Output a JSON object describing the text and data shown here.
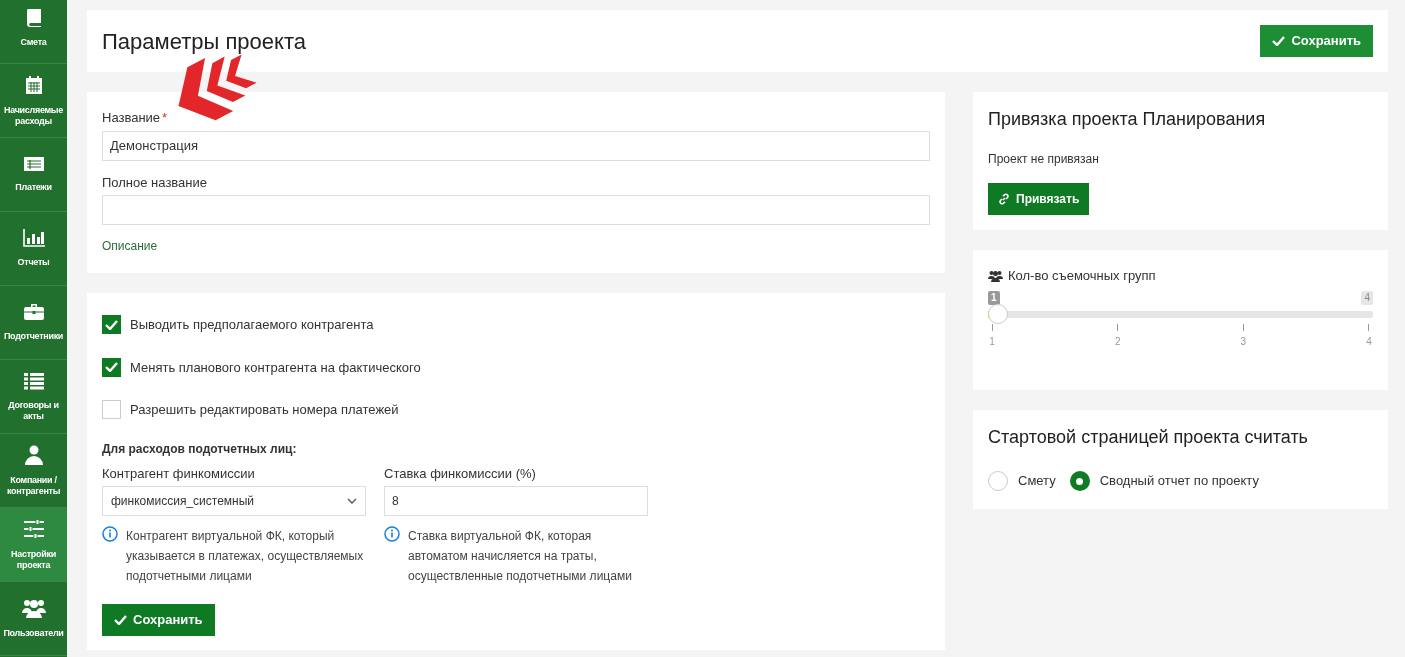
{
  "sidebar": {
    "items": [
      {
        "label": "Смета",
        "selected": false
      },
      {
        "label": "Начисляемые расходы",
        "selected": false
      },
      {
        "label": "Платежи",
        "selected": false
      },
      {
        "label": "Отчеты",
        "selected": false
      },
      {
        "label": "Подотчетники",
        "selected": false
      },
      {
        "label": "Договоры и акты",
        "selected": false
      },
      {
        "label": "Компании / контрагенты",
        "selected": false
      },
      {
        "label": "Настройки проекта",
        "selected": true
      },
      {
        "label": "Пользователи",
        "selected": false
      }
    ]
  },
  "header": {
    "title": "Параметры проекта",
    "save_button": "Сохранить"
  },
  "name_card": {
    "name_label": "Название",
    "required_mark": "*",
    "name_value": "Демонстрация",
    "full_name_label": "Полное название",
    "description_link": "Описание"
  },
  "options_card": {
    "checkboxes": [
      {
        "label": "Выводить предполагаемого контрагента",
        "checked": true
      },
      {
        "label": "Менять планового контрагента на фактического",
        "checked": true
      },
      {
        "label": "Разрешить редактировать номера платежей",
        "checked": false
      }
    ],
    "section_title": "Для расходов подотчетных лиц:",
    "counterparty_label": "Контрагент финкомиссии",
    "counterparty_value": "финкомиссия_системный",
    "rate_label": "Ставка финкомиссии (%)",
    "rate_value": "8",
    "counterparty_hint": "Контрагент виртуальной ФК, который указывается в платежах, осуществляемых подотчетными лицами",
    "rate_hint": "Ставка виртуальной ФК, которая автоматом начисляется на траты, осуществленные подотчетными лицами",
    "save_button": "Сохранить"
  },
  "binding_card": {
    "title": "Привязка проекта Планирования",
    "status": "Проект не привязан",
    "bind_button": "Привязать"
  },
  "crews_card": {
    "label": "Кол-во съемочных групп",
    "value_badge": "1",
    "max_badge": "4",
    "level": 0,
    "ticks": [
      "1",
      "2",
      "3",
      "4"
    ]
  },
  "start_page_card": {
    "title": "Стартовой страницей проекта считать",
    "options": [
      {
        "label": "Смету",
        "selected": false
      },
      {
        "label": "Сводный отчет по проекту",
        "selected": true
      }
    ]
  }
}
